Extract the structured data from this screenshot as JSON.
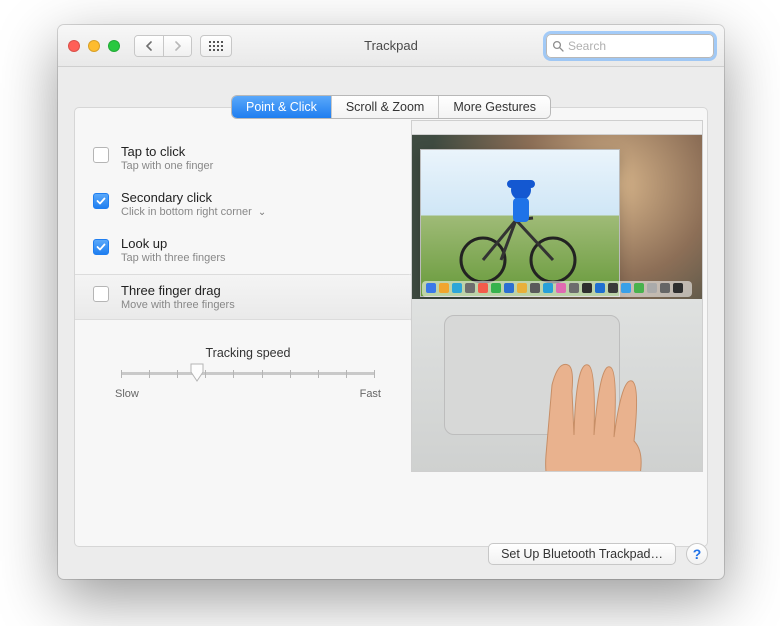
{
  "window": {
    "title": "Trackpad"
  },
  "search": {
    "placeholder": "Search"
  },
  "tabs": [
    {
      "label": "Point & Click",
      "selected": true
    },
    {
      "label": "Scroll & Zoom",
      "selected": false
    },
    {
      "label": "More Gestures",
      "selected": false
    }
  ],
  "options": {
    "tap_to_click": {
      "title": "Tap to click",
      "sub": "Tap with one finger",
      "checked": false,
      "highlighted": false
    },
    "secondary_click": {
      "title": "Secondary click",
      "sub": "Click in bottom right corner",
      "checked": true,
      "highlighted": false,
      "has_menu": true
    },
    "look_up": {
      "title": "Look up",
      "sub": "Tap with three fingers",
      "checked": true,
      "highlighted": false
    },
    "three_finger_drag": {
      "title": "Three finger drag",
      "sub": "Move with three fingers",
      "checked": false,
      "highlighted": true
    }
  },
  "tracking_speed": {
    "label": "Tracking speed",
    "slow_label": "Slow",
    "fast_label": "Fast",
    "ticks": 10,
    "position_percent": 30
  },
  "footer": {
    "bluetooth_button": "Set Up Bluetooth Trackpad…"
  },
  "dock_icon_colors": [
    "#3a78e8",
    "#f0a52e",
    "#2da6d8",
    "#6e6e6e",
    "#f25b4b",
    "#37b24d",
    "#2c6fd1",
    "#e8b03a",
    "#5a5a5a",
    "#27a0d8",
    "#e06ab1",
    "#6d6d6d",
    "#2e2e2e",
    "#1e6fd0",
    "#3a3a3a",
    "#3aa0e8",
    "#49b24d",
    "#aaaaaa",
    "#666666",
    "#2e2e2e"
  ]
}
